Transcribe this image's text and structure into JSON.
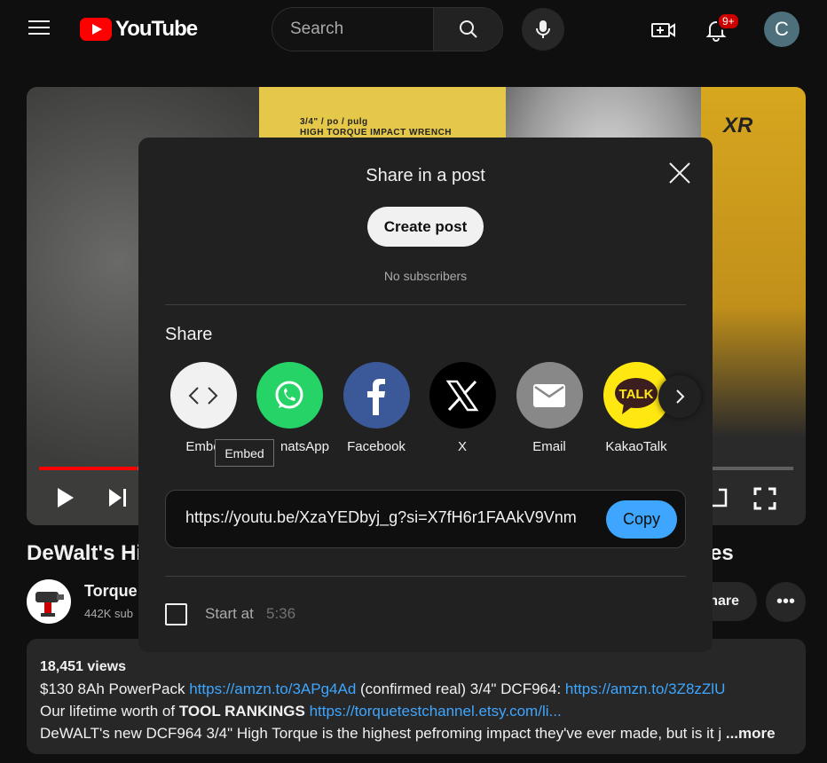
{
  "header": {
    "logo_text": "YouTube",
    "search_placeholder": "Search",
    "notification_count": "9+",
    "avatar_letter": "C"
  },
  "video": {
    "box_text_line1": "3/4\" / po / pulg",
    "box_text_line2": "HIGH TORQUE IMPACT WRENCH",
    "brand_mark": "XR",
    "progress_fraction": 0.13
  },
  "below": {
    "title_start": "DeWalt's Hi",
    "title_end": "es",
    "channel_name": "Torque",
    "channel_subs": "442K sub",
    "share_label": "hare",
    "more_label": "•••"
  },
  "description": {
    "views": "18,451 views",
    "line1_text": "$130 8Ah PowerPack ",
    "line1_link1": "https://amzn.to/3APg4Ad",
    "line1_mid": " (confirmed real) 3/4\" DCF964: ",
    "line1_link2": "https://amzn.to/3Z8zZlU",
    "line2_text": "Our lifetime worth of ",
    "line2_bold": "TOOL RANKINGS",
    "line2_link": "https://torquetestchannel.etsy.com/li...",
    "line3_text": "DeWALT's new DCF964 3/4\" High Torque is the highest pefroming impact they've ever made, but is it j",
    "line3_more": "...more"
  },
  "dialog": {
    "title": "Share in a post",
    "create_post": "Create post",
    "no_subscribers": "No subscribers",
    "share_heading": "Share",
    "items": [
      {
        "name": "Embed",
        "color": "#f1f1f1",
        "icon": "embed-icon"
      },
      {
        "name": "WhatsApp",
        "color": "#25d366",
        "icon": "whatsapp-icon"
      },
      {
        "name": "Facebook",
        "color": "#3b5998",
        "icon": "facebook-icon"
      },
      {
        "name": "X",
        "color": "#000000",
        "icon": "x-icon"
      },
      {
        "name": "Email",
        "color": "#888888",
        "icon": "email-icon"
      },
      {
        "name": "KakaoTalk",
        "color": "#ffe812",
        "icon": "kakaotalk-icon"
      }
    ],
    "embed_visible": "Embe",
    "whatsapp_visible": "natsApp",
    "tooltip": "Embed",
    "url": "https://youtu.be/XzaYEDbyj_g?si=X7fH6r1FAAkV9Vnm",
    "copy": "Copy",
    "start_at_label": "Start at",
    "start_at_time": "5:36"
  }
}
